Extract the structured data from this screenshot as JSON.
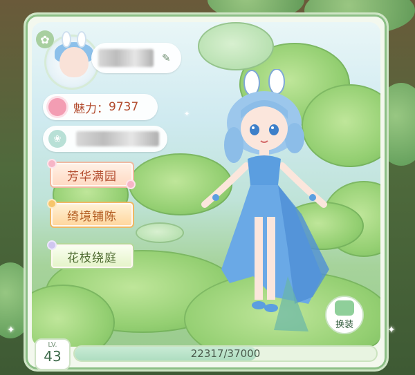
{
  "profile": {
    "charm_label": "魅力：",
    "charm_value": "9737"
  },
  "nav": {
    "btn1": "芳华满园",
    "btn2": "绮境铺陈",
    "btn3": "花枝绕庭"
  },
  "change_outfit_label": "换装",
  "level": {
    "prefix": "LV.",
    "value": "43",
    "xp_text": "22317/37000",
    "xp_fraction": 0.603
  },
  "icons": [
    "gear-icon",
    "edit-icon",
    "rose-icon",
    "footprint-icon",
    "shirt-icon"
  ],
  "colors": {
    "accent_green": "#8cbf86",
    "charm_text": "#b24a2c",
    "dress_blue": "#5b9ee0"
  }
}
